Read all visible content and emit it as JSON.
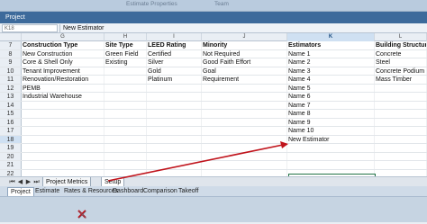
{
  "ribbon": {
    "labels": [
      "Estimate Properties",
      "Team"
    ]
  },
  "panel": {
    "title": "Project"
  },
  "formula_bar": {
    "cell_ref": "K18",
    "value": "New Estimator"
  },
  "columns": [
    {
      "letter": "G"
    },
    {
      "letter": "H"
    },
    {
      "letter": "I"
    },
    {
      "letter": "J"
    },
    {
      "letter": "K"
    },
    {
      "letter": "L"
    }
  ],
  "rows": [
    {
      "num": "7",
      "cells": [
        "Construction Type",
        "Site Type",
        "LEED Rating",
        "Minority",
        "Estimators",
        "Building Structure"
      ]
    },
    {
      "num": "8",
      "cells": [
        "New Construction",
        "Green Field",
        "Certified",
        "Not Required",
        "Name 1",
        "Concrete"
      ]
    },
    {
      "num": "9",
      "cells": [
        "Core & Shell Only",
        "Existing",
        "Silver",
        "Good Faith Effort",
        "Name 2",
        "Steel"
      ]
    },
    {
      "num": "10",
      "cells": [
        "Tenant Improvement",
        "",
        "Gold",
        "Goal",
        "Name 3",
        "Concrete Podium /"
      ]
    },
    {
      "num": "11",
      "cells": [
        "Renovation/Restoration",
        "",
        "Platinum",
        "Requirement",
        "Name 4",
        "Mass Timber"
      ]
    },
    {
      "num": "12",
      "cells": [
        "PEMB",
        "",
        "",
        "",
        "Name 5",
        ""
      ]
    },
    {
      "num": "13",
      "cells": [
        "Industrial Warehouse",
        "",
        "",
        "",
        "Name 6",
        ""
      ]
    },
    {
      "num": "14",
      "cells": [
        "",
        "",
        "",
        "",
        "Name 7",
        ""
      ]
    },
    {
      "num": "15",
      "cells": [
        "",
        "",
        "",
        "",
        "Name 8",
        ""
      ]
    },
    {
      "num": "16",
      "cells": [
        "",
        "",
        "",
        "",
        "Name 9",
        ""
      ]
    },
    {
      "num": "17",
      "cells": [
        "",
        "",
        "",
        "",
        "Name 10",
        ""
      ]
    },
    {
      "num": "18",
      "cells": [
        "",
        "",
        "",
        "",
        "New Estimator",
        ""
      ]
    },
    {
      "num": "19",
      "cells": [
        "",
        "",
        "",
        "",
        "",
        ""
      ]
    },
    {
      "num": "20",
      "cells": [
        "",
        "",
        "",
        "",
        "",
        ""
      ]
    },
    {
      "num": "21",
      "cells": [
        "",
        "",
        "",
        "",
        "",
        ""
      ]
    },
    {
      "num": "22",
      "cells": [
        "",
        "",
        "",
        "",
        "",
        ""
      ]
    }
  ],
  "sheet_tabs": [
    "Project Metrics",
    "Setup"
  ],
  "nav_icons": [
    "first-sheet-icon",
    "prev-sheet-icon",
    "next-sheet-icon",
    "last-sheet-icon"
  ],
  "view_tabs": [
    "Project",
    "Estimate",
    "Rates & Resources",
    "Dashboard",
    "Comparison",
    "Takeoff"
  ],
  "colors": {
    "accent": "#3d6a9b",
    "arrow": "#c0141c"
  }
}
